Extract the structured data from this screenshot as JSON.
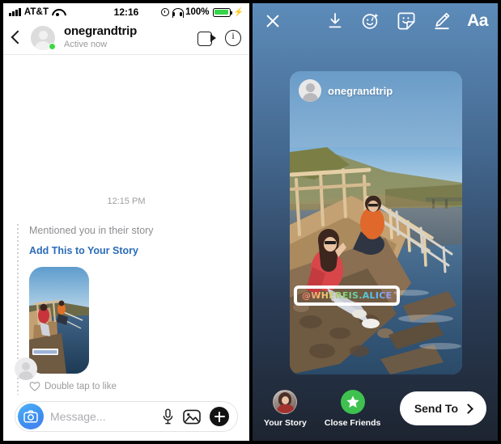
{
  "status_bar": {
    "carrier": "AT&T",
    "time": "12:16",
    "battery_percent": "100%",
    "icons": [
      "signal-icon",
      "wifi-icon",
      "alarm-icon",
      "headphones-icon",
      "battery-icon",
      "charging-bolt-icon"
    ]
  },
  "dm_header": {
    "username": "onegrandtrip",
    "status": "Active now",
    "back_icon": "back-chevron-icon",
    "video_icon": "video-call-icon",
    "info_icon": "info-icon"
  },
  "thread": {
    "timestamp": "12:15 PM",
    "mentioned_text": "Mentioned you in their story",
    "add_story_link": "Add This to Your Story",
    "double_tap_text": "Double tap to like",
    "heart_icon": "heart-icon"
  },
  "composer": {
    "camera_icon": "camera-icon",
    "placeholder": "Message...",
    "value": "",
    "mic_icon": "microphone-icon",
    "photo_icon": "photo-library-icon",
    "plus_icon": "plus-icon"
  },
  "story": {
    "toolbar": {
      "close_icon": "close-icon",
      "save_icon": "download-icon",
      "effects_icon": "sparkle-face-icon",
      "sticker_icon": "sticker-icon",
      "draw_icon": "pen-icon",
      "text_label": "Aa"
    },
    "card": {
      "username": "onegrandtrip",
      "mention_sticker": "@WHEREIS.ALICE"
    },
    "destinations": [
      {
        "label": "Your Story",
        "icon": "your-story-avatar"
      },
      {
        "label": "Close Friends",
        "icon": "green-star-icon"
      }
    ],
    "send_to": {
      "label": "Send To",
      "chevron_icon": "chevron-right-icon"
    }
  },
  "colors": {
    "link_blue": "#2b6cb8",
    "online_green": "#3bd94a",
    "battery_green": "#36d54a",
    "close_friends_green": "#3ec14f",
    "story_bg_top": "#5d8cba",
    "story_bg_bottom": "#1d2430"
  }
}
